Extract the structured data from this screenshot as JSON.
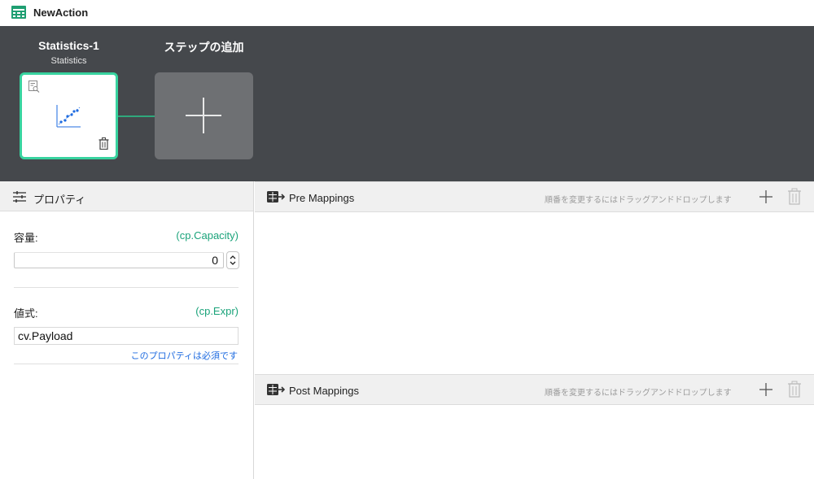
{
  "window": {
    "title": "NewAction"
  },
  "canvas": {
    "steps": [
      {
        "title": "Statistics-1",
        "subtitle": "Statistics"
      }
    ],
    "add_step_label": "ステップの追加"
  },
  "properties": {
    "header": "プロパティ",
    "fields": [
      {
        "label": "容量:",
        "variable": "(cp.Capacity)",
        "value": "0"
      },
      {
        "label": "値式:",
        "variable": "(cp.Expr)",
        "value": "cv.Payload",
        "hint": "このプロパティは必須です"
      }
    ]
  },
  "pre_mappings": {
    "title": "Pre Mappings",
    "hint": "順番を変更するにはドラッグアンドドロップします"
  },
  "post_mappings": {
    "title": "Post Mappings",
    "hint": "順番を変更するにはドラッグアンドドロップします"
  },
  "colors": {
    "canvas_bg": "#45484c",
    "step_border": "#38d39f",
    "connector": "#2fa87c",
    "variable_text": "#1aa37a",
    "hint_link": "#1e6be0"
  }
}
